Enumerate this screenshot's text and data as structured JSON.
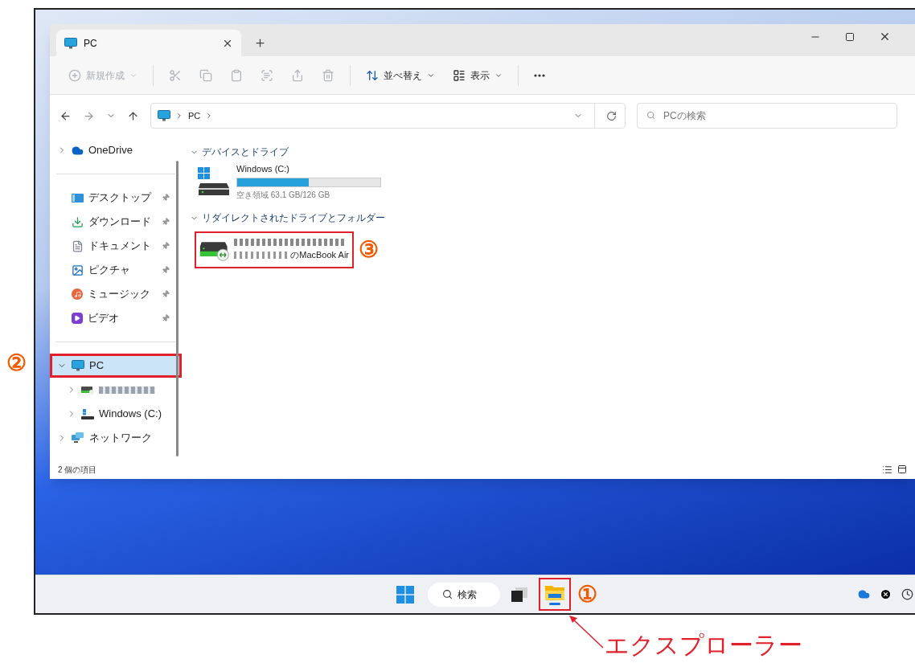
{
  "window": {
    "tabs": [
      {
        "title": "PC",
        "selected": true
      }
    ]
  },
  "toolbar": [
    {
      "kind": "new",
      "label": "新規作成",
      "disabled": true
    },
    {
      "kind": "cut",
      "disabled": true
    },
    {
      "kind": "copy",
      "disabled": true
    },
    {
      "kind": "paste",
      "disabled": true
    },
    {
      "kind": "rename",
      "disabled": true
    },
    {
      "kind": "share",
      "disabled": true
    },
    {
      "kind": "delete",
      "disabled": true
    },
    {
      "kind": "sort",
      "label": "並べ替え",
      "disabled": false
    },
    {
      "kind": "view",
      "label": "表示",
      "disabled": false
    },
    {
      "kind": "more",
      "disabled": false
    }
  ],
  "address": {
    "path": [
      "PC"
    ],
    "search_placeholder": "PCの検索"
  },
  "sidebar": {
    "groups": [
      [
        {
          "label": "OneDrive",
          "kind": "onedrive",
          "expanded": false
        }
      ],
      [
        {
          "label": "デスクトップ",
          "kind": "desktop",
          "pinned": true
        },
        {
          "label": "ダウンロード",
          "kind": "download",
          "pinned": true
        },
        {
          "label": "ドキュメント",
          "kind": "documents",
          "pinned": true
        },
        {
          "label": "ピクチャ",
          "kind": "pictures",
          "pinned": true
        },
        {
          "label": "ミュージック",
          "kind": "music",
          "pinned": true
        },
        {
          "label": "ビデオ",
          "kind": "videos",
          "pinned": true
        }
      ],
      [
        {
          "label": "PC",
          "kind": "pc",
          "expanded": true,
          "selected": true,
          "annotation": "②",
          "children": [
            {
              "kind": "netdrive",
              "expanded": false
            },
            {
              "label": "Windows (C:)",
              "kind": "drive",
              "expanded": false
            }
          ]
        },
        {
          "label": "ネットワーク",
          "kind": "network",
          "expanded": false
        }
      ]
    ]
  },
  "sections": [
    {
      "title": "デバイスとドライブ",
      "expanded": true,
      "items": [
        {
          "kind": "drive",
          "name": "Windows (C:)",
          "level": 0.5,
          "free": "空き領域 63.1 GB/126 GB"
        }
      ]
    },
    {
      "title": "リダイレクトされたドライブとフォルダー",
      "expanded": true,
      "items": [
        {
          "kind": "redirect",
          "name": "のMacBook Air",
          "annotation": "③"
        }
      ]
    }
  ],
  "status_bar": {
    "count": "2 個の項目"
  },
  "taskbar": [
    {
      "kind": "start"
    },
    {
      "kind": "search",
      "label": "検索"
    },
    {
      "kind": "taskview"
    },
    {
      "kind": "explorer",
      "active": true,
      "annotation": "①"
    }
  ],
  "callout": {
    "text": "エクスプローラー"
  }
}
